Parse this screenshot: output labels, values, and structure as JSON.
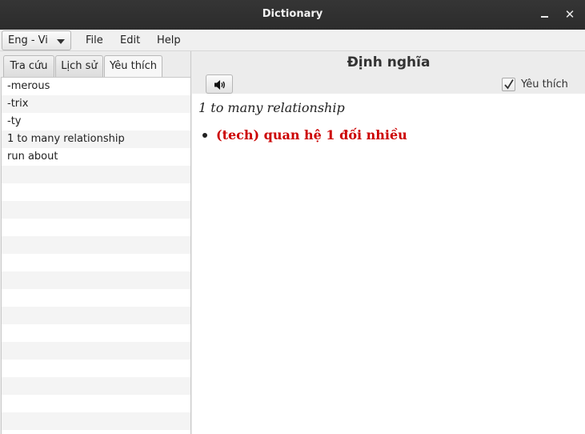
{
  "window": {
    "title": "Dictionary"
  },
  "menubar": {
    "language": "Eng - Vi",
    "menus": [
      "File",
      "Edit",
      "Help"
    ]
  },
  "tabs": [
    {
      "label": "Tra cứu",
      "active": false
    },
    {
      "label": "Lịch sử",
      "active": false
    },
    {
      "label": "Yêu thích",
      "active": true
    }
  ],
  "favorites": [
    "-merous",
    "-trix",
    "-ty",
    "1 to many relationship",
    "run about"
  ],
  "definition": {
    "header": "Định nghĩa",
    "favorite_label": "Yêu thích",
    "favorite_checked": true,
    "word": "1 to many relationship",
    "meanings": [
      "(tech) quan hệ 1 đối nhiều"
    ]
  }
}
